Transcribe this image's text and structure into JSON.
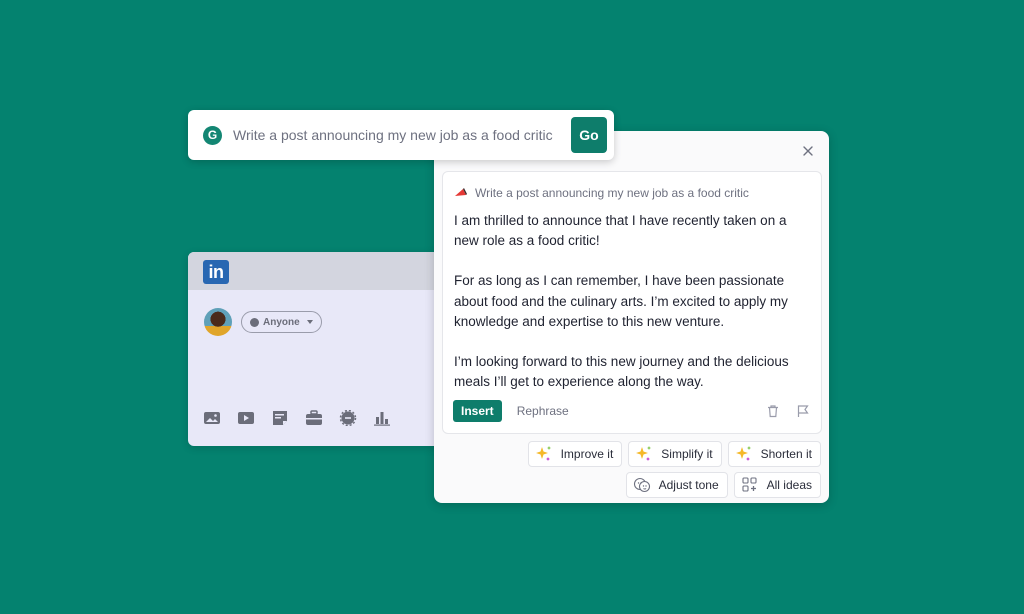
{
  "colors": {
    "background": "#04826f",
    "brand_green": "#0e7d6b",
    "linkedin_blue": "#2867b2"
  },
  "prompt_bar": {
    "logo_icon": "grammarly-g-icon",
    "logo_letter": "G",
    "text": "Write a post announcing my new job as a food critic",
    "go_label": "Go"
  },
  "linkedin_card": {
    "logo_text": "in",
    "visibility_label": "Anyone",
    "toolbar_icons": [
      "photo-icon",
      "video-icon",
      "document-icon",
      "briefcase-icon",
      "badge-icon",
      "chart-icon"
    ]
  },
  "panel": {
    "close_icon": "close-icon",
    "prompt_echo": "Write a post announcing my new job as a food critic",
    "paragraphs": [
      "I am thrilled to announce that I have recently taken on a new role as a food critic!",
      "For as long as I can remember, I have been passionate about food and the culinary arts. I’m excited to apply my knowledge and expertise to this new venture.",
      "I’m looking forward to this new journey and the delicious meals I’ll get to experience along the way."
    ],
    "insert_label": "Insert",
    "rephrase_label": "Rephrase",
    "chips_row1": [
      "Improve it",
      "Simplify it",
      "Shorten it"
    ],
    "chips_row2": [
      "Adjust tone",
      "All ideas"
    ]
  }
}
